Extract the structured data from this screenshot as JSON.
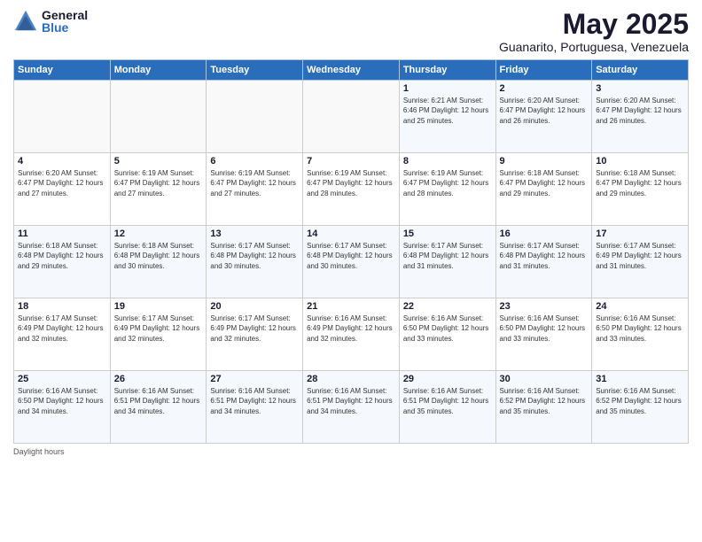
{
  "logo": {
    "general": "General",
    "blue": "Blue"
  },
  "title": "May 2025",
  "location": "Guanarito, Portuguesa, Venezuela",
  "days_of_week": [
    "Sunday",
    "Monday",
    "Tuesday",
    "Wednesday",
    "Thursday",
    "Friday",
    "Saturday"
  ],
  "weeks": [
    [
      {
        "num": "",
        "info": ""
      },
      {
        "num": "",
        "info": ""
      },
      {
        "num": "",
        "info": ""
      },
      {
        "num": "",
        "info": ""
      },
      {
        "num": "1",
        "info": "Sunrise: 6:21 AM\nSunset: 6:46 PM\nDaylight: 12 hours\nand 25 minutes."
      },
      {
        "num": "2",
        "info": "Sunrise: 6:20 AM\nSunset: 6:47 PM\nDaylight: 12 hours\nand 26 minutes."
      },
      {
        "num": "3",
        "info": "Sunrise: 6:20 AM\nSunset: 6:47 PM\nDaylight: 12 hours\nand 26 minutes."
      }
    ],
    [
      {
        "num": "4",
        "info": "Sunrise: 6:20 AM\nSunset: 6:47 PM\nDaylight: 12 hours\nand 27 minutes."
      },
      {
        "num": "5",
        "info": "Sunrise: 6:19 AM\nSunset: 6:47 PM\nDaylight: 12 hours\nand 27 minutes."
      },
      {
        "num": "6",
        "info": "Sunrise: 6:19 AM\nSunset: 6:47 PM\nDaylight: 12 hours\nand 27 minutes."
      },
      {
        "num": "7",
        "info": "Sunrise: 6:19 AM\nSunset: 6:47 PM\nDaylight: 12 hours\nand 28 minutes."
      },
      {
        "num": "8",
        "info": "Sunrise: 6:19 AM\nSunset: 6:47 PM\nDaylight: 12 hours\nand 28 minutes."
      },
      {
        "num": "9",
        "info": "Sunrise: 6:18 AM\nSunset: 6:47 PM\nDaylight: 12 hours\nand 29 minutes."
      },
      {
        "num": "10",
        "info": "Sunrise: 6:18 AM\nSunset: 6:47 PM\nDaylight: 12 hours\nand 29 minutes."
      }
    ],
    [
      {
        "num": "11",
        "info": "Sunrise: 6:18 AM\nSunset: 6:48 PM\nDaylight: 12 hours\nand 29 minutes."
      },
      {
        "num": "12",
        "info": "Sunrise: 6:18 AM\nSunset: 6:48 PM\nDaylight: 12 hours\nand 30 minutes."
      },
      {
        "num": "13",
        "info": "Sunrise: 6:17 AM\nSunset: 6:48 PM\nDaylight: 12 hours\nand 30 minutes."
      },
      {
        "num": "14",
        "info": "Sunrise: 6:17 AM\nSunset: 6:48 PM\nDaylight: 12 hours\nand 30 minutes."
      },
      {
        "num": "15",
        "info": "Sunrise: 6:17 AM\nSunset: 6:48 PM\nDaylight: 12 hours\nand 31 minutes."
      },
      {
        "num": "16",
        "info": "Sunrise: 6:17 AM\nSunset: 6:48 PM\nDaylight: 12 hours\nand 31 minutes."
      },
      {
        "num": "17",
        "info": "Sunrise: 6:17 AM\nSunset: 6:49 PM\nDaylight: 12 hours\nand 31 minutes."
      }
    ],
    [
      {
        "num": "18",
        "info": "Sunrise: 6:17 AM\nSunset: 6:49 PM\nDaylight: 12 hours\nand 32 minutes."
      },
      {
        "num": "19",
        "info": "Sunrise: 6:17 AM\nSunset: 6:49 PM\nDaylight: 12 hours\nand 32 minutes."
      },
      {
        "num": "20",
        "info": "Sunrise: 6:17 AM\nSunset: 6:49 PM\nDaylight: 12 hours\nand 32 minutes."
      },
      {
        "num": "21",
        "info": "Sunrise: 6:16 AM\nSunset: 6:49 PM\nDaylight: 12 hours\nand 32 minutes."
      },
      {
        "num": "22",
        "info": "Sunrise: 6:16 AM\nSunset: 6:50 PM\nDaylight: 12 hours\nand 33 minutes."
      },
      {
        "num": "23",
        "info": "Sunrise: 6:16 AM\nSunset: 6:50 PM\nDaylight: 12 hours\nand 33 minutes."
      },
      {
        "num": "24",
        "info": "Sunrise: 6:16 AM\nSunset: 6:50 PM\nDaylight: 12 hours\nand 33 minutes."
      }
    ],
    [
      {
        "num": "25",
        "info": "Sunrise: 6:16 AM\nSunset: 6:50 PM\nDaylight: 12 hours\nand 34 minutes."
      },
      {
        "num": "26",
        "info": "Sunrise: 6:16 AM\nSunset: 6:51 PM\nDaylight: 12 hours\nand 34 minutes."
      },
      {
        "num": "27",
        "info": "Sunrise: 6:16 AM\nSunset: 6:51 PM\nDaylight: 12 hours\nand 34 minutes."
      },
      {
        "num": "28",
        "info": "Sunrise: 6:16 AM\nSunset: 6:51 PM\nDaylight: 12 hours\nand 34 minutes."
      },
      {
        "num": "29",
        "info": "Sunrise: 6:16 AM\nSunset: 6:51 PM\nDaylight: 12 hours\nand 35 minutes."
      },
      {
        "num": "30",
        "info": "Sunrise: 6:16 AM\nSunset: 6:52 PM\nDaylight: 12 hours\nand 35 minutes."
      },
      {
        "num": "31",
        "info": "Sunrise: 6:16 AM\nSunset: 6:52 PM\nDaylight: 12 hours\nand 35 minutes."
      }
    ]
  ],
  "footer": "Daylight hours"
}
